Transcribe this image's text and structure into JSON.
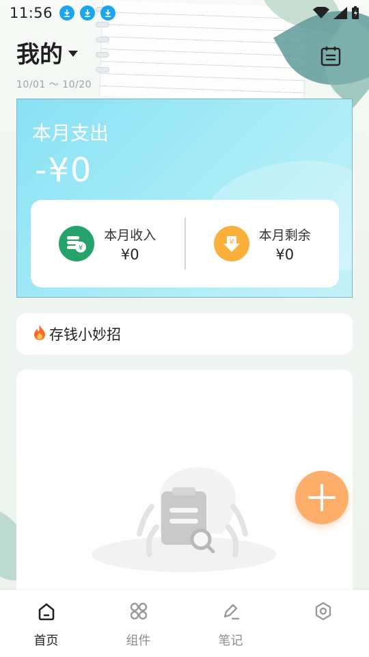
{
  "status_bar": {
    "time": "11:56"
  },
  "header": {
    "title": "我的",
    "date_range": "10/01 ～ 10/20"
  },
  "summary": {
    "expense_label": "本月支出",
    "expense_amount": "-¥0",
    "income_label": "本月收入",
    "income_value": "¥0",
    "balance_label": "本月剩余",
    "balance_value": "¥0"
  },
  "tips": {
    "label": "存钱小妙招"
  },
  "nav": {
    "items": [
      {
        "label": "首页",
        "icon": "home-icon"
      },
      {
        "label": "组件",
        "icon": "widgets-icon"
      },
      {
        "label": "笔记",
        "icon": "pen-icon"
      },
      {
        "label": "",
        "icon": "settings-icon"
      }
    ]
  },
  "colors": {
    "accent": "#fdae6b",
    "card": "#89e1f4",
    "income": "#25a36b",
    "balance": "#fbb03b"
  }
}
